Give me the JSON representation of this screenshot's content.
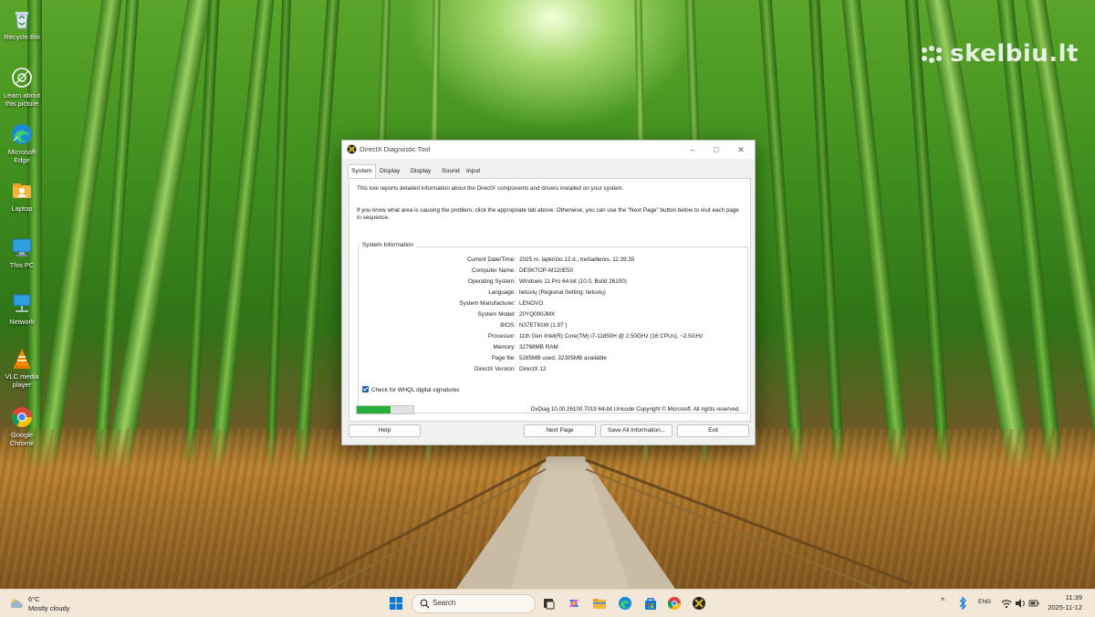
{
  "desktop": {
    "watermark": "skelbiu.lt",
    "icons": [
      {
        "label": "Recycle Bin",
        "icon": "recycle-bin-icon"
      },
      {
        "label": "Learn about this picture",
        "icon": "camera-icon"
      },
      {
        "label": "Microsoft Edge",
        "icon": "edge-icon"
      },
      {
        "label": "Laptop",
        "icon": "folder-icon"
      },
      {
        "label": "This PC",
        "icon": "monitor-icon"
      },
      {
        "label": "Network",
        "icon": "network-icon"
      },
      {
        "label": "VLC media player",
        "icon": "vlc-icon"
      },
      {
        "label": "Google Chrome",
        "icon": "chrome-icon"
      }
    ]
  },
  "window": {
    "title": "DirectX Diagnostic Tool",
    "tabs": [
      "System",
      "Display 1",
      "Display 2",
      "Sound",
      "Input"
    ],
    "active_tab": "System",
    "intro_1": "This tool reports detailed information about the DirectX components and drivers installed on your system.",
    "intro_2": "If you know what area is causing the problem, click the appropriate tab above.  Otherwise, you can use the \"Next Page\" button below to visit each page in sequence.",
    "section_title": "System Information",
    "rows": [
      {
        "label": "Current Date/Time:",
        "value": "2025 m. lapkričio 12 d., trečiadienis, 11:39:35"
      },
      {
        "label": "Computer Name:",
        "value": "DESKTOP-M120E50"
      },
      {
        "label": "Operating System:",
        "value": "Windows 11 Pro 64-bit (10.0, Build 26100)"
      },
      {
        "label": "Language:",
        "value": "lietuvių (Regional Setting: lietuvių)"
      },
      {
        "label": "System Manufacturer:",
        "value": "LENOVO"
      },
      {
        "label": "System Model:",
        "value": "20YQ000JMX"
      },
      {
        "label": "BIOS:",
        "value": "N37ET61W (1.97 )"
      },
      {
        "label": "Processor:",
        "value": "11th Gen Intel(R) Core(TM) i7-11850H @ 2.50GHz (16 CPUs), ~2.5GHz"
      },
      {
        "label": "Memory:",
        "value": "32768MB RAM"
      },
      {
        "label": "Page file:",
        "value": "5285MB used, 32305MB available"
      },
      {
        "label": "DirectX Version:",
        "value": "DirectX 12"
      }
    ],
    "whql_label": "Check for WHQL digital signatures",
    "whql_checked": true,
    "progress_fraction": 0.6,
    "copyright": "DxDiag 10.00.26100.7019 64-bit Unicode  Copyright © Microsoft. All rights reserved.",
    "buttons": {
      "help": "Help",
      "next": "Next Page",
      "save": "Save All Information...",
      "exit": "Exit"
    }
  },
  "taskbar": {
    "weather_temp": "6°C",
    "weather_condition": "Mostly cloudy",
    "search_placeholder": "Search",
    "language": "ENG",
    "time": "11:39",
    "date": "2025-11-12"
  }
}
